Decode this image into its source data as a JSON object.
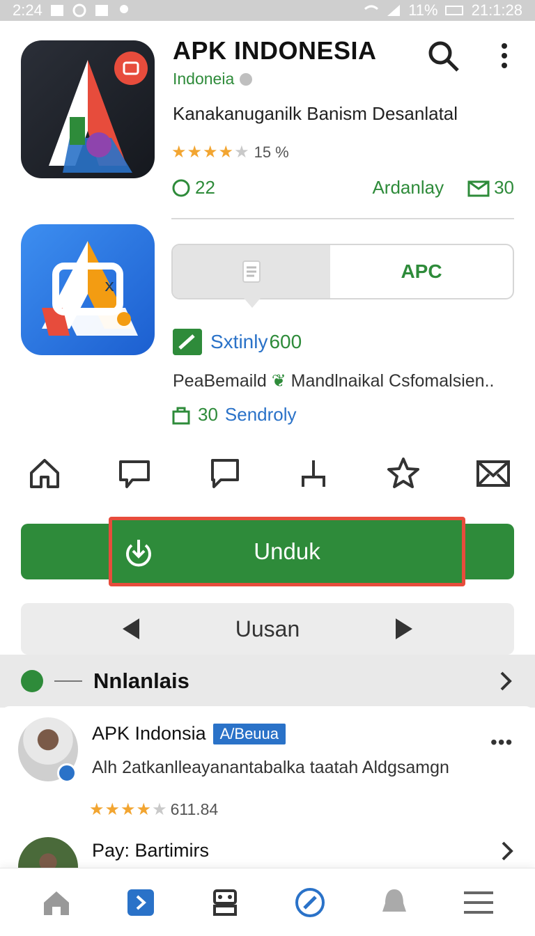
{
  "status_bar": {
    "time": "2:24",
    "battery": "11%",
    "clock_right": "21:1:28"
  },
  "app": {
    "title": "APK INDONESIA",
    "developer": "Indoneia",
    "tagline": "Kanakanuganilk Banism Desanlatal",
    "rating_pct": "15 %",
    "meta_left": "22",
    "meta_mid": "Ardanlay",
    "meta_right": "30"
  },
  "segment": {
    "right_label": "APC"
  },
  "sxt": {
    "label": "Sxtinly",
    "suffix": "600"
  },
  "pea_text": "PeaBemaild",
  "pea_text2": "Mandlnaikal Csfomalsien..",
  "sen_count": "30",
  "sen_label": "Sendroly",
  "download": {
    "label": "Unduk"
  },
  "update": {
    "label": "Uusan"
  },
  "reviews": {
    "header_title": "Nnlanlais",
    "items": [
      {
        "name": "APK Indonsia",
        "badge": "A/Beuua",
        "text": "Alh 2atkanlleayanantabalka taatah Aldgsamgn",
        "rating_value": "611.84"
      },
      {
        "name": "Pay: Bartimirs"
      }
    ]
  },
  "colors": {
    "accent_green": "#2e8b3a",
    "accent_blue": "#2a72c8",
    "highlight_red": "#e74c3c",
    "star": "#f2a531"
  },
  "icons": {
    "action_row": [
      "home-icon",
      "chat-icon",
      "comment-icon",
      "share-icon",
      "star-icon",
      "mail-icon"
    ],
    "bottom_nav": [
      "home-icon",
      "store-icon",
      "robot-icon",
      "compass-icon",
      "bell-icon",
      "menu-icon"
    ]
  }
}
